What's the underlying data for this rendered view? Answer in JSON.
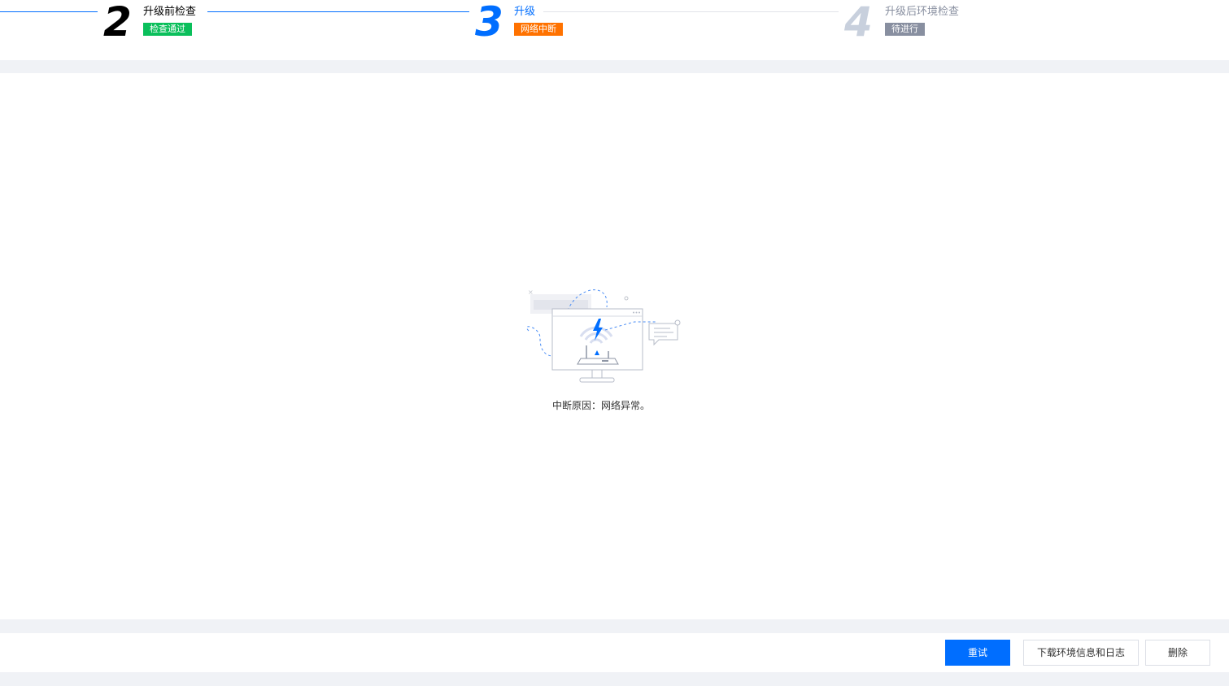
{
  "steps": [
    {
      "number": "2",
      "title": "升级前检查",
      "badge": "检查通过",
      "badge_color": "#0abf5b",
      "state": "done"
    },
    {
      "number": "3",
      "title": "升级",
      "badge": "网络中断",
      "badge_color": "#ff7200",
      "state": "active"
    },
    {
      "number": "4",
      "title": "升级后环境检查",
      "badge": "待进行",
      "badge_color": "#888fa0",
      "state": "pending"
    }
  ],
  "interrupt": {
    "illustration_icon": "network-disconnected-illustration",
    "reason_text": "中断原因：网络异常。"
  },
  "footer": {
    "retry_label": "重试",
    "download_label": "下载环境信息和日志",
    "delete_label": "删除"
  },
  "colors": {
    "primary": "#006eff",
    "done_text": "#000000",
    "pending_text": "#888fa0",
    "pending_number": "#c8d0dd"
  }
}
